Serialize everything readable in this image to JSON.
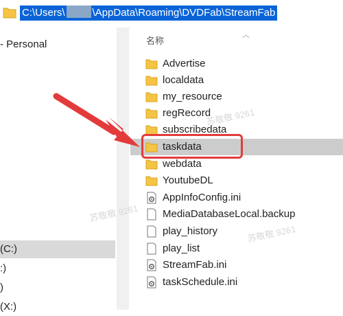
{
  "address_bar": {
    "path_prefix": "C:\\Users\\",
    "path_suffix": "\\AppData\\Roaming\\DVDFab\\StreamFab"
  },
  "nav_pane": {
    "items": [
      {
        "label": "- Personal"
      },
      {
        "label": "(C:)"
      },
      {
        "label": ":)"
      },
      {
        "label": ")"
      },
      {
        "label": "(X:)"
      }
    ]
  },
  "content": {
    "column_header": "名称",
    "files": [
      {
        "name": "Advertise",
        "icon": "folder-icon"
      },
      {
        "name": "localdata",
        "icon": "folder-icon"
      },
      {
        "name": "my_resource",
        "icon": "folder-icon"
      },
      {
        "name": "regRecord",
        "icon": "folder-icon"
      },
      {
        "name": "subscribedata",
        "icon": "folder-icon"
      },
      {
        "name": "taskdata",
        "icon": "folder-icon"
      },
      {
        "name": "webdata",
        "icon": "folder-icon"
      },
      {
        "name": "YoutubeDL",
        "icon": "folder-icon"
      },
      {
        "name": "AppInfoConfig.ini",
        "icon": "settings-file-icon"
      },
      {
        "name": "MediaDatabaseLocal.backup",
        "icon": "file-icon"
      },
      {
        "name": "play_history",
        "icon": "file-icon"
      },
      {
        "name": "play_list",
        "icon": "file-icon"
      },
      {
        "name": "StreamFab.ini",
        "icon": "settings-file-icon"
      },
      {
        "name": "taskSchedule.ini",
        "icon": "settings-file-icon"
      }
    ]
  },
  "watermark": {
    "text": "苏敬敬 9261"
  },
  "colors": {
    "selection_blue": "#0a64d8",
    "highlight_red": "#e33b3b",
    "folder_yellow": "#f5c445"
  }
}
